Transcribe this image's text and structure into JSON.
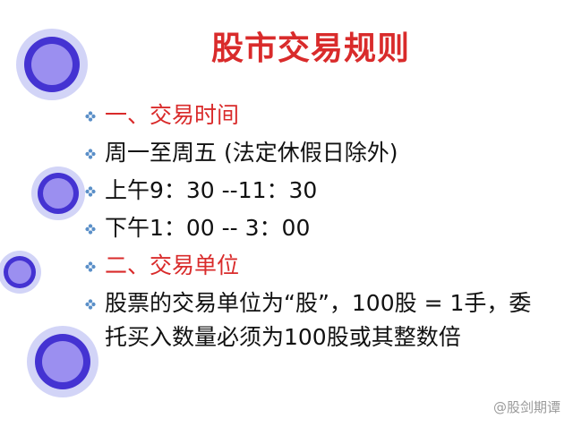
{
  "slide": {
    "title": "股市交易规则",
    "bullets": [
      {
        "text": "一、交易时间",
        "style": "heading"
      },
      {
        "text": "周一至周五 (法定休假日除外)",
        "style": "body"
      },
      {
        "text": "上午9：30 --11：30",
        "style": "body"
      },
      {
        "text": "下午1：00 -- 3：00",
        "style": "body"
      },
      {
        "text": "二、交易单位",
        "style": "heading"
      },
      {
        "text": "股票的交易单位为“股”，100股 = 1手，委托买入数量必须为100股或其整数倍",
        "style": "body"
      }
    ],
    "bullet_icon": "flower-bullet-icon",
    "watermark": "@股剑期谭"
  },
  "colors": {
    "heading": "#d92b2b",
    "body": "#111111",
    "ring_outer": "#c9ccf5",
    "ring_inner": "#4a3fd6",
    "ring_fill": "#8d84ec",
    "bullet_icon": "#5a8fc8"
  }
}
